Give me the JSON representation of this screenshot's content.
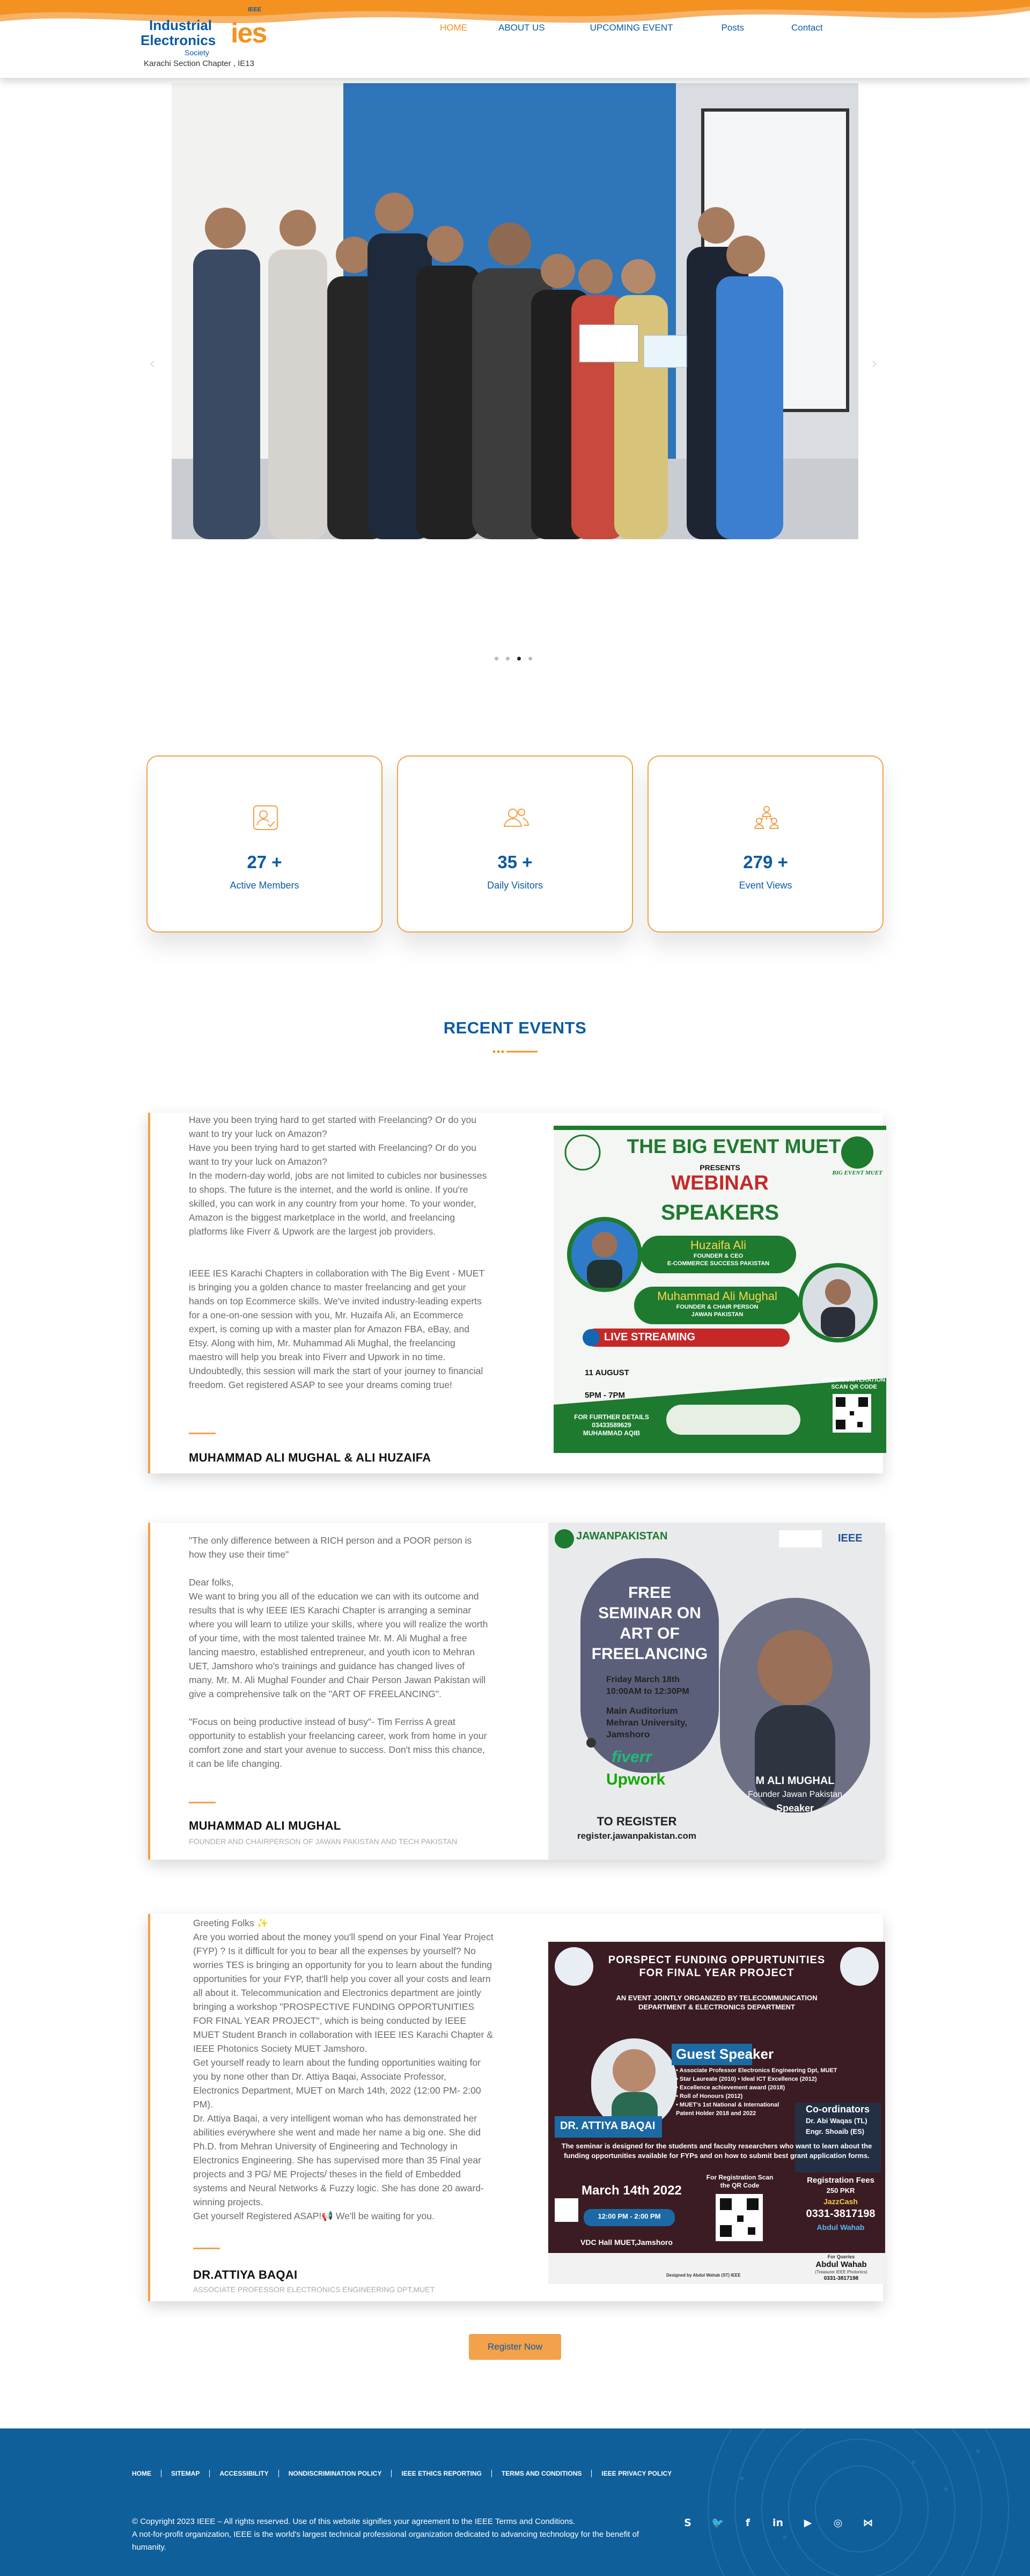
{
  "logo": {
    "line1": "Industrial",
    "line2": "Electronics",
    "society": "Society",
    "brand_mark": "ies",
    "ieee_tag": "IEEE",
    "subtitle": "Karachi Section Chapter , IE13"
  },
  "nav": {
    "items": [
      {
        "label": "HOME",
        "active": true
      },
      {
        "label": "ABOUT US",
        "active": false
      },
      {
        "label": "UPCOMING EVENT",
        "active": false
      },
      {
        "label": "Posts",
        "active": false
      },
      {
        "label": "Contact",
        "active": false
      }
    ]
  },
  "hero": {
    "prev_icon": "chevron-left-icon",
    "next_icon": "chevron-right-icon",
    "prev_glyph": "‹",
    "next_glyph": "›",
    "slide_count": 4,
    "active_slide": 3
  },
  "stats": [
    {
      "icon": "user-check-icon",
      "value": "27 +",
      "label": "Active Members"
    },
    {
      "icon": "users-icon",
      "value": "35 +",
      "label": "Daily Visitors"
    },
    {
      "icon": "network-users-icon",
      "value": "279 +",
      "label": "Event Views"
    }
  ],
  "recent_events": {
    "title": "RECENT EVENTS",
    "events": [
      {
        "text": "Have you been trying hard to get started with Freelancing? Or do you want to try your luck on Amazon?\nHave you been trying hard to get started with Freelancing? Or do you want to try your luck on Amazon?\nIn the modern-day world, jobs are not limited to cubicles nor businesses to shops. The future is the internet, and the world is online. If you're skilled, you can work in any country from your home. To your wonder, Amazon is the biggest marketplace in the world, and freelancing platforms like Fiverr & Upwork are the largest job providers.\n\n\nIEEE IES Karachi Chapters in collaboration with The Big Event - MUET is bringing you a golden chance to master freelancing and get your hands on top Ecommerce skills. We've invited industry-leading experts for a one-on-one session with you, Mr. Huzaifa Ali, an Ecommerce expert, is coming up with a master plan for Amazon FBA, eBay, and Etsy. Along with him, Mr. Muhammad Ali Mughal, the freelancing maestro will help you break into Fiverr and Upwork in no time. Undoubtedly, this session will mark the start of your journey to financial freedom. Get registered ASAP to see your dreams coming true!",
        "name": "MUHAMMAD ALI MUGHAL & ALI HUZAIFA",
        "role": "",
        "poster": {
          "heading": "THE BIG EVENT MUET",
          "presents": "PRESENTS",
          "webinar": "WEBINAR",
          "speakers": "SPEAKERS",
          "speaker1_name": "Huzaifa Ali",
          "speaker1_title": "FOUNDER & CEO\nE-COMMERCE SUCCESS PAKISTAN",
          "speaker2_name": "Muhammad Ali Mughal",
          "speaker2_title": "FOUNDER & CHAIR PERSON\nJAWAN PAKISTAN",
          "live": "LIVE STREAMING",
          "date": "11 AUGUST",
          "time": "5PM - 7PM",
          "details": "FOR FURTHER DETAILS\n03433589629\nMUHAMMAD AQIB",
          "qr_label": "FOR REGISTERATION\nSCAN QR CODE",
          "logo_tag": "BIG EVENT MUET"
        }
      },
      {
        "text": "\"The only difference between a RICH person and a POOR person is how they use their time\"\n\nDear folks,\nWe want to bring you all of the education we can with its outcome and results that is why IEEE IES Karachi Chapter is arranging a seminar where you will learn to utilize your skills, where you will realize the worth of your time, with the most talented trainee Mr. M. Ali Mughal a free lancing maestro, established entrepreneur, and youth icon to Mehran UET, Jamshoro who's trainings and guidance has changed lives of many. Mr. M. Ali Mughal Founder and Chair Person Jawan Pakistan will give a comprehensive talk on the \"ART OF FREELANCING\".\n\n\"Focus on being productive instead of busy\"- Tim Ferriss A great opportunity to establish your freelancing career, work from home in your comfort zone and start your avenue to success. Don't miss this chance, it can be life changing.",
        "name": "MUHAMMAD ALI MUGHAL",
        "role": "FOUNDER AND CHAIRPERSON OF JAWAN PAKISTAN AND TECH PAKISTAN",
        "poster": {
          "brand": "JAWANPAKISTAN",
          "ieee": "IEEE",
          "headline": "FREE\nSEMINAR ON\nART OF\nFREELANCING",
          "date": "Friday March 18th\n10:00AM to 12:30PM",
          "venue": "Main Auditorium\nMehran University,\nJamshoro",
          "fiverr": "fiverr",
          "upwork": "Upwork",
          "speaker_name": "M ALI MUGHAL",
          "speaker_title": "Founder Jawan Pakistan",
          "speaker_role": "Speaker",
          "register": "TO REGISTER",
          "url": "register.jawanpakistan.com"
        }
      },
      {
        "text": "Greeting Folks ✨\nAre you worried about the money you'll spend on your Final Year Project (FYP) ? Is it difficult for you to bear all the expenses by yourself? No worries TES is bringing an opportunity for you to learn about the funding opportunities for your FYP, that'll help you cover all your costs and learn all about it. Telecommunication and Electronics department are jointly bringing a workshop \"PROSPECTIVE FUNDING OPPORTUNITIES FOR FINAL YEAR PROJECT\", which is being conducted by IEEE MUET Student Branch in collaboration with IEEE IES Karachi Chapter & IEEE Photonics Society MUET Jamshoro.\nGet yourself ready to learn about the funding opportunities waiting for you by none other than Dr. Attiya Baqai, Associate Professor, Electronics Department, MUET on March 14th, 2022 (12:00 PM- 2:00 PM).\nDr. Attiya Baqai, a very intelligent woman who has demonstrated her abilities everywhere she went and made her name a big one. She did Ph.D. from Mehran University of Engineering and Technology in Electronics Engineering. She has supervised more than 35 Final year projects and 3 PG/ ME Projects/ theses in the field of Embedded systems and Neural Networks & Fuzzy logic. She has done 20 award-winning projects.\nGet yourself Registered ASAP!📢 We'll be waiting for you.",
        "name": "DR.ATTIYA BAQAI",
        "role": "ASSOCIATE PROFESSOR Electronics Engineering DPT,MUET",
        "poster": {
          "title": "PORSPECT FUNDING OPPURTUNITIES\nFOR FINAL YEAR PROJECT",
          "subtitle": "AN EVENT JOINTLY ORGANIZED BY TELECOMMUNICATION\nDEPARTMENT & ELECTRONICS DEPARTMENT",
          "guest": "Guest Speaker",
          "bullets": "• Associate Professor Electronics Engineering Dpt, MUET\n• Star Laureate (2010)      • Ideal ICT Excellence (2012)\n• Excellence achievement award (2018)\n• Roll of Honours (2012)\n• MUET's 1st National & International\n  Patent Holder 2018 and 2022",
          "speaker": "DR. ATTIYA BAQAI",
          "coord_title": "Co-ordinators",
          "coord1": "Dr. Abi Waqas (TL)",
          "coord2": "Engr. Shoaib (ES)",
          "blurb": "The seminar is designed for the students and faculty researchers who want to learn about the funding opportunities available for FYPs and on how to submit best grant application forms.",
          "date": "March 14th 2022",
          "time": "12:00 PM - 2:00 PM",
          "scan": "For Registration Scan\nthe QR Code",
          "fees_label": "Registration Fees",
          "fees": "250 PKR",
          "jazzcash": "JazzCash",
          "phone": "0331-3817198",
          "account": "Abdul Wahab",
          "venue": "VDC Hall MUET,Jamshoro",
          "contact_label": "For Queries",
          "contact_name": "Abdul Wahab",
          "contact_role": "(Treasurer IEEE Photonics)",
          "contact_phone": "0331-3817198",
          "designed_by": "Designed by Abdul Wahab (ST) IEEE"
        }
      }
    ]
  },
  "register_button": "Register Now",
  "footer": {
    "links": [
      "HOME",
      "SITEMAP",
      "ACCESSIBILITY",
      "NONDISCRIMINATION POLICY",
      "IEEE ETHICS REPORTING",
      "TERMS AND CONDITIONS",
      "IEEE PRIVACY POLICY"
    ],
    "copyright": "© Copyright 2023 IEEE – All rights reserved. Use of this website signifies your agreement to the IEEE Terms and Conditions.\nA not-for-profit organization, IEEE is the world's largest technical professional organization dedicated to advancing technology for the benefit of humanity.",
    "social": [
      {
        "icon": "skype-icon",
        "glyph": "S"
      },
      {
        "icon": "twitter-icon",
        "glyph": "🐦"
      },
      {
        "icon": "facebook-icon",
        "glyph": "f"
      },
      {
        "icon": "linkedin-icon",
        "glyph": "in"
      },
      {
        "icon": "youtube-icon",
        "glyph": "▶"
      },
      {
        "icon": "instagram-icon",
        "glyph": "◎"
      },
      {
        "icon": "share-icon",
        "glyph": "⋈"
      }
    ]
  },
  "colors": {
    "brand_blue": "#0b5aa5",
    "accent_orange": "#f39221",
    "footer_blue": "#0f5f9a"
  }
}
